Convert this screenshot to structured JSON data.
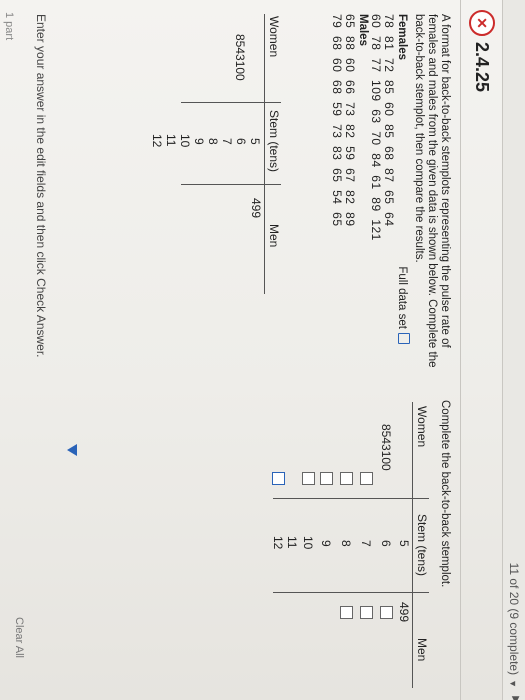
{
  "topbar": {
    "progress": "11 of 20 (9 complete)"
  },
  "header": {
    "question_number": "2.4.25"
  },
  "prompt": "A format for back-to-back stemplots representing the pulse rate of females and males from the given data is shown below. Complete the back-to-back stemplot, then compare the results.",
  "data_block": {
    "females_label": "Females",
    "full_data_label": "Full data set",
    "females_rows": [
      "78  81  72  85  60  85  68  87  65  64",
      "60  78  77  109  63  70  84  61  89  121"
    ],
    "males_label": "Males",
    "males_rows": [
      "65  88  60  66  73  82  59  67  82  89",
      "79  68  60  68  59  73  83  65  54  65"
    ]
  },
  "left_stemplot": {
    "women_header": "Women",
    "stem_header": "Stem (tens)",
    "men_header": "Men",
    "women_leaves": "8543100",
    "men_leaves": "499",
    "stems": [
      "5",
      "6",
      "7",
      "8",
      "9",
      "10",
      "11",
      "12"
    ]
  },
  "right_panel": {
    "instruction": "Complete the back-to-back stemplot.",
    "women_header": "Women",
    "stem_header": "Stem (tens)",
    "men_header": "Men",
    "women_leaves": "8543100",
    "men_leaves": "499",
    "stems": [
      "5",
      "6",
      "7",
      "8",
      "9",
      "10",
      "11",
      "12"
    ]
  },
  "footer": {
    "message": "Enter your answer in the edit fields and then click Check Answer.",
    "clear_all": "Clear All",
    "part": "1 part"
  }
}
